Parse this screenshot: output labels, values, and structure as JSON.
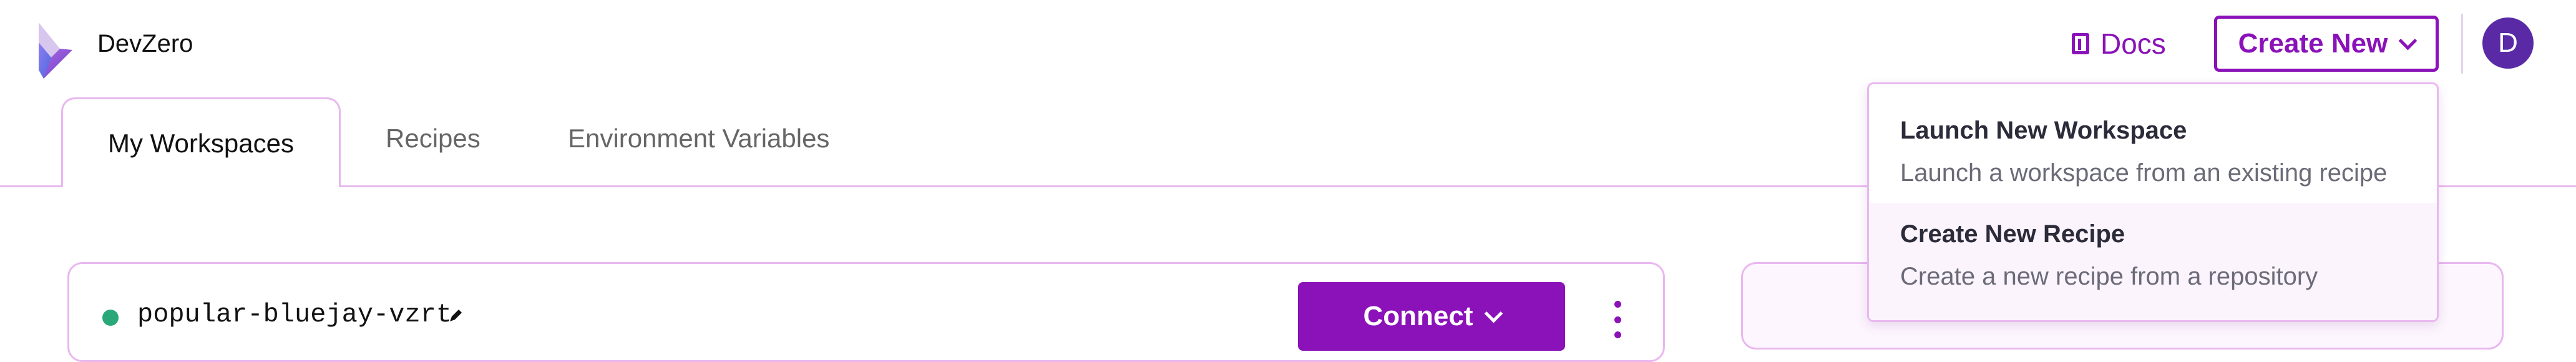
{
  "header": {
    "brand": "DevZero",
    "docs_label": "Docs",
    "create_new_label": "Create New",
    "avatar_initial": "D"
  },
  "tabs": [
    {
      "label": "My Workspaces",
      "active": true
    },
    {
      "label": "Recipes",
      "active": false
    },
    {
      "label": "Environment Variables",
      "active": false
    }
  ],
  "workspace": {
    "status": "running",
    "name": "popular-bluejay-vzrt",
    "connect_label": "Connect"
  },
  "menu": {
    "items": [
      {
        "title": "Launch New Workspace",
        "description": "Launch a workspace from an existing recipe"
      },
      {
        "title": "Create New Recipe",
        "description": "Create a new recipe from a repository"
      }
    ]
  },
  "colors": {
    "accent": "#8a12b8",
    "border": "#e9b8ef",
    "status_running": "#2aa87a",
    "avatar_bg": "#5a2aa6"
  },
  "icons": [
    "devzero-logo",
    "book-icon",
    "chevron-down-icon",
    "pencil-icon",
    "kebab-menu-icon"
  ]
}
